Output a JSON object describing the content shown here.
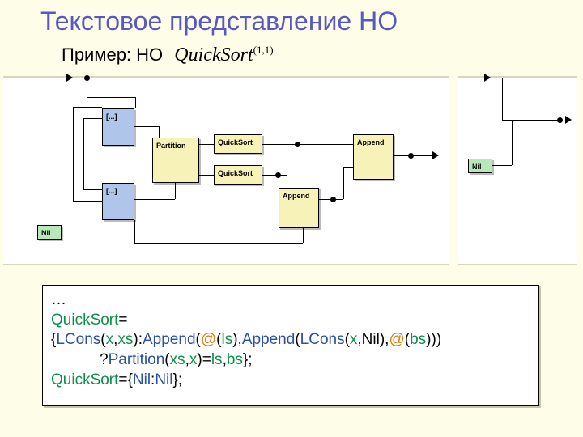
{
  "title": "Текстовое представление НО",
  "subtitle_prefix": "Пример: НО",
  "subtitle_math": "QuickSort",
  "subtitle_sup": "(1,1)",
  "diagram": {
    "left": {
      "boxes": {
        "nil": "Nil",
        "case1": "[...]",
        "case2": "[...]",
        "partition": "Partition",
        "qs1": "QuickSort",
        "qs2": "QuickSort",
        "append1": "Append",
        "append2": "Append"
      }
    },
    "right": {
      "boxes": {
        "nil": "Nil"
      }
    }
  },
  "code": {
    "l1": "…",
    "l2a": "QuickSort",
    "l2b": "=",
    "l3a": "{",
    "l3b": "LCons",
    "l3c": "(",
    "l3d": "x",
    "l3e": ",",
    "l3f": "xs",
    "l3g": "):",
    "l3h": "Append",
    "l3i": "(",
    "l3j": "@",
    "l3k": "(",
    "l3l": "ls",
    "l3m": "),",
    "l3n": "Append",
    "l3o": "(",
    "l3p": "LCons",
    "l3q": "(",
    "l3r": "x",
    "l3s": ",Nil",
    "l3t": "),",
    "l3u": "@",
    "l3v": "(",
    "l3w": "bs",
    "l3x": ")))",
    "l4a": "?",
    "l4b": "Partition",
    "l4c": "(",
    "l4d": "xs",
    "l4e": ",",
    "l4f": "x",
    "l4g": ")=",
    "l4h": "ls",
    "l4i": ",",
    "l4j": "bs",
    "l4k": "};",
    "l5a": "QuickSort",
    "l5b": "={",
    "l5c": "Nil",
    "l5d": ":",
    "l5e": "Nil",
    "l5f": "};"
  }
}
